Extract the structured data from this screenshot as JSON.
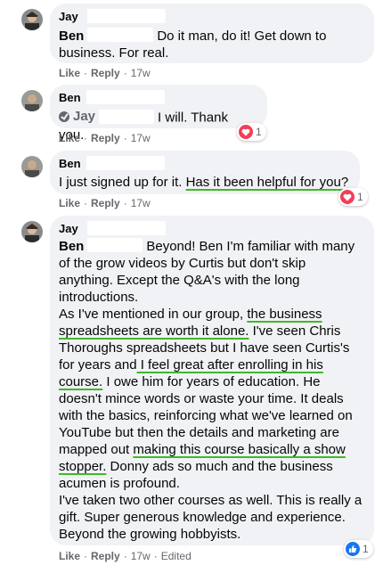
{
  "comments": [
    {
      "author": "Jay",
      "mention": "Ben",
      "text": "Do it man, do it! Get down to business. For real.",
      "actions": {
        "like": "Like",
        "reply": "Reply",
        "time": "17w"
      }
    },
    {
      "author": "Ben",
      "mention": "Jay",
      "text": "I will. Thank you.",
      "actions": {
        "like": "Like",
        "reply": "Reply",
        "time": "17w"
      },
      "reaction": {
        "icon": "heart-icon",
        "count": "1"
      }
    },
    {
      "author": "Ben",
      "text_plain": "I just signed up for it. ",
      "text_underlined": "Has it been helpful for you?",
      "actions": {
        "like": "Like",
        "reply": "Reply",
        "time": "17w"
      },
      "reaction": {
        "icon": "heart-icon",
        "count": "1"
      }
    },
    {
      "author": "Jay",
      "mention": "Ben",
      "p1_a": "Beyond! Ben I'm familiar with many of the grow videos by Curtis but don't skip anything. Except the Q&A's with the long introductions.",
      "p2_a": "As I've mentioned in our group, ",
      "p2_u1": "the business spreadsheets are worth it alone.",
      "p2_b": " I've seen Chris Thoroughs spreadsheets but I have seen Curtis's for years and",
      "p2_u2": " I feel great after enrolling in his course.",
      "p2_c": " I owe him for years of education. He doesn't mince words or waste your time. It deals with the basics, reinforcing what we've learned on YouTube but then the details and marketing are mapped out ",
      "p2_u3": "making this course basically a show stopper.",
      "p2_d": " Donny ads so much and the business acumen is profound.",
      "p3": "I've taken two other courses as well. This is really a gift. Super generous knowledge and experience. Beyond the growing hobbyists.",
      "actions": {
        "like": "Like",
        "reply": "Reply",
        "time": "17w",
        "edited": "Edited"
      },
      "reaction": {
        "icon": "like-icon",
        "count": "1"
      }
    }
  ],
  "colors": {
    "bubble": "#f0f2f5",
    "underline": "#42b72a",
    "heart": "#f33e58",
    "like": "#1877f2",
    "meta": "#65676b"
  }
}
